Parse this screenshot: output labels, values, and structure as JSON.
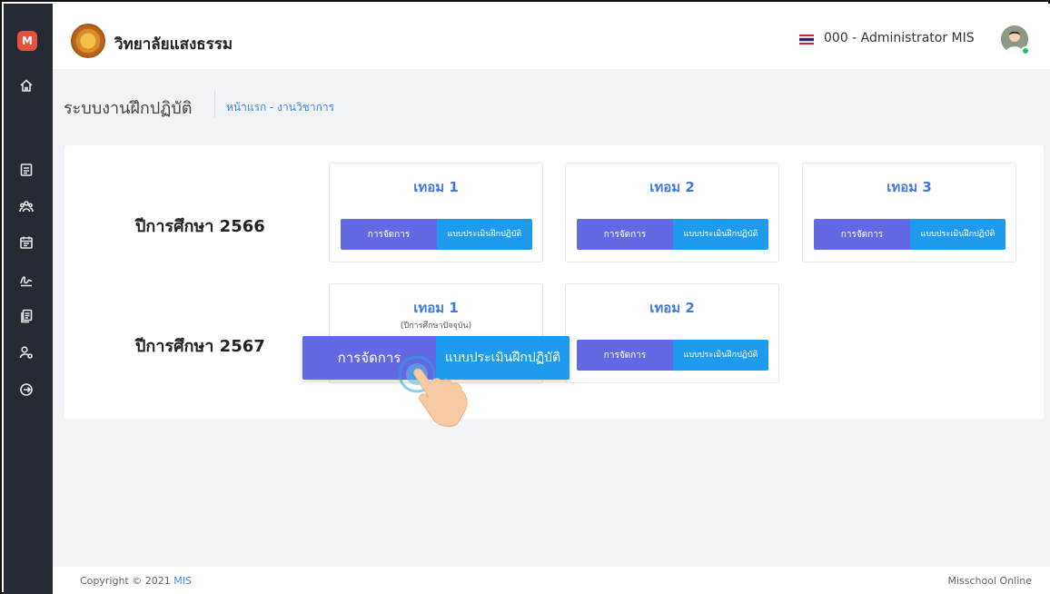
{
  "header": {
    "school_name": "วิทยาลัยแสงธรรม",
    "user": "000 - Administrator MIS",
    "logo_letter": "M"
  },
  "page": {
    "title": "ระบบงานฝึกปฏิบัติ",
    "breadcrumb": [
      "หน้าแรก",
      "- งานวิชาการ"
    ]
  },
  "years": [
    {
      "label": "ปีการศึกษา 2566",
      "terms": [
        {
          "title": "เทอม 1",
          "manage": "การจัดการ",
          "eval": "แบบประเมินฝึกปฏิบัติ"
        },
        {
          "title": "เทอม 2",
          "manage": "การจัดการ",
          "eval": "แบบประเมินฝึกปฏิบัติ"
        },
        {
          "title": "เทอม 3",
          "manage": "การจัดการ",
          "eval": "แบบประเมินฝึกปฏิบัติ"
        }
      ]
    },
    {
      "label": "ปีการศึกษา 2567",
      "terms": [
        {
          "title": "เทอม 1",
          "subtitle": "(ปีการศึกษาปัจจุบัน)",
          "manage": "การจัดการ",
          "eval": "แบบประเมินฝึกปฏิบัติ"
        },
        {
          "title": "เทอม 2",
          "manage": "การจัดการ",
          "eval": "แบบประเมินฝึกปฏิบัติ"
        }
      ]
    }
  ],
  "footer": {
    "copyright": "Copyright © 2021",
    "link": "MIS",
    "right": "Misschool Online"
  },
  "colors": {
    "sidebar": "#262b33",
    "manage_button": "#6369e3",
    "eval_button": "#1e9bec",
    "term_title": "#3f79df"
  },
  "icons": [
    "home-icon",
    "document-icon",
    "users-group-icon",
    "calendar-icon",
    "signature-icon",
    "files-icon",
    "user-settings-icon",
    "logout-icon"
  ]
}
